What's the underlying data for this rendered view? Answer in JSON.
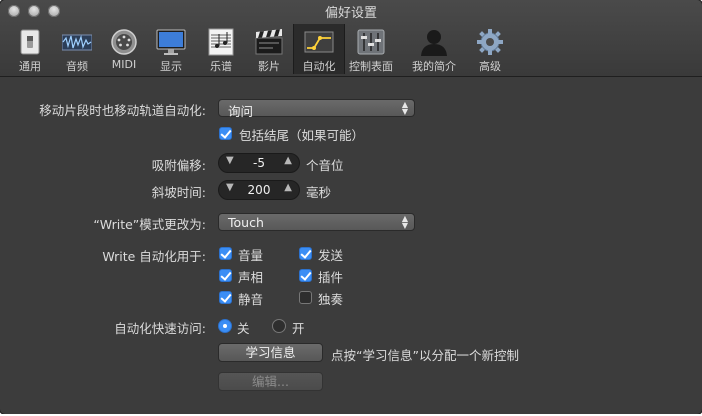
{
  "window": {
    "title": "偏好设置"
  },
  "toolbar": {
    "items": [
      {
        "label": "通用",
        "icon": "switch-icon"
      },
      {
        "label": "音频",
        "icon": "waveform-icon"
      },
      {
        "label": "MIDI",
        "icon": "midi-port-icon"
      },
      {
        "label": "显示",
        "icon": "monitor-icon"
      },
      {
        "label": "乐谱",
        "icon": "score-icon"
      },
      {
        "label": "影片",
        "icon": "clapperboard-icon"
      },
      {
        "label": "自动化",
        "icon": "automation-icon",
        "active": true
      },
      {
        "label": "控制表面",
        "icon": "faders-icon"
      },
      {
        "label": "我的简介",
        "icon": "profile-silhouette-icon"
      },
      {
        "label": "高级",
        "icon": "gear-icon"
      }
    ]
  },
  "settings": {
    "move_automation_label": "移动片段时也移动轨道自动化:",
    "move_automation_value": "询问",
    "include_tails_label": "包括结尾（如果可能）",
    "include_tails_checked": true,
    "snap_offset_label": "吸附偏移:",
    "snap_offset_value": "-5",
    "snap_offset_unit": "个音位",
    "ramp_time_label": "斜坡时间:",
    "ramp_time_value": "200",
    "ramp_time_unit": "毫秒",
    "write_mode_label": "“Write”模式更改为:",
    "write_mode_value": "Touch",
    "write_for_label": "Write 自动化用于:",
    "write_for": [
      {
        "label": "音量",
        "checked": true
      },
      {
        "label": "发送",
        "checked": true
      },
      {
        "label": "声相",
        "checked": true
      },
      {
        "label": "插件",
        "checked": true
      },
      {
        "label": "静音",
        "checked": true
      },
      {
        "label": "独奏",
        "checked": false
      }
    ],
    "quick_access_label": "自动化快速访问:",
    "quick_access_off": "关",
    "quick_access_on": "开",
    "quick_access_selected": "关",
    "learn_button": "学习信息",
    "learn_hint": "点按“学习信息”以分配一个新控制",
    "edit_button": "编辑..."
  },
  "colors": {
    "accent": "#3b8ef5",
    "window_bg": "#3c3c3c",
    "text": "#dcdcdc"
  }
}
